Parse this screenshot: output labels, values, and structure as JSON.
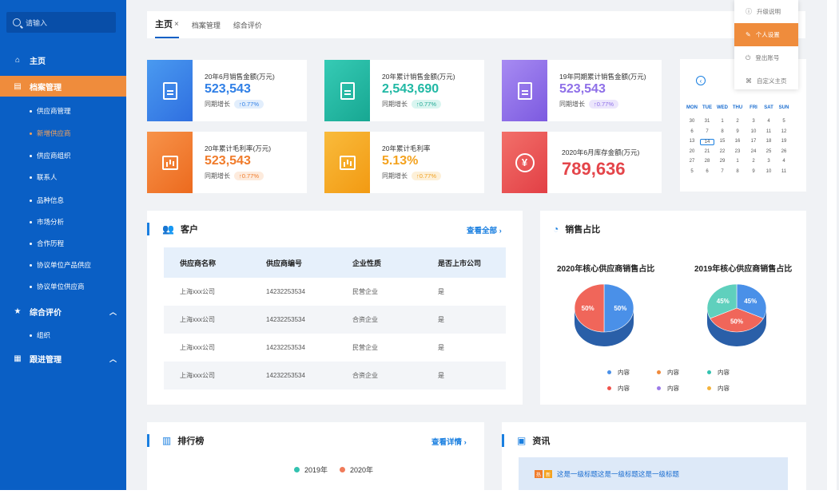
{
  "search": {
    "placeholder": "请输入"
  },
  "sidebar": {
    "top": [
      {
        "label": "主页",
        "icon": "home-icon"
      },
      {
        "label": "档案管理",
        "icon": "archive-icon"
      },
      {
        "label": "综合评价",
        "icon": "star-icon"
      },
      {
        "label": "跟进管理",
        "icon": "follow-icon"
      }
    ],
    "archive_sub": [
      "供应商管理",
      "新增供应商",
      "供应商组织",
      "联系人",
      "品种信息",
      "市场分析",
      "合作历程",
      "协议单位产品供应",
      "协议单位供应商"
    ],
    "eval_sub": [
      "组织"
    ]
  },
  "tabs": {
    "home": "主页",
    "close": "×",
    "archive": "档案管理",
    "eval": "综合评价"
  },
  "dropdown": [
    "升级说明",
    "个人设置",
    "登出账号",
    "自定义主页"
  ],
  "cards": [
    {
      "title": "20年6月销售金额(万元)",
      "value": "523,543",
      "cmp_label": "同期增长",
      "cmp": "↑0.77%",
      "color": "#2f7fe6"
    },
    {
      "title": "20年累计销售金额(万元)",
      "value": "2,543,690",
      "cmp_label": "同期增长",
      "cmp": "↑0.77%",
      "color": "#20b8a4"
    },
    {
      "title": "19年同期累计销售金额(万元)",
      "value": "523,543",
      "cmp_label": "同期增长",
      "cmp": "↑0.77%",
      "color": "#8e6fe8"
    },
    {
      "title": "20年累计毛利率(万元)",
      "value": "523,543",
      "cmp_label": "同期增长",
      "cmp": "↑0.77%",
      "color": "#f07b2a"
    },
    {
      "title": "20年累计毛利率",
      "value": "5.13%",
      "cmp_label": "同期增长",
      "cmp": "↑0.77%",
      "color": "#f4a21e"
    },
    {
      "title": "2020年6月库存金额(万元)",
      "value": "789,636",
      "color": "#e4454a"
    }
  ],
  "calendar": {
    "dow": [
      "MON",
      "TUE",
      "WED",
      "THU",
      "FRI",
      "SAT",
      "SUN"
    ],
    "weeks": [
      [
        "30",
        "31",
        "1",
        "2",
        "3",
        "4",
        "5"
      ],
      [
        "6",
        "7",
        "8",
        "9",
        "10",
        "11",
        "12"
      ],
      [
        "13",
        "14",
        "15",
        "16",
        "17",
        "18",
        "19"
      ],
      [
        "20",
        "21",
        "22",
        "23",
        "24",
        "25",
        "26"
      ],
      [
        "27",
        "28",
        "29",
        "1",
        "2",
        "3",
        "4"
      ],
      [
        "5",
        "6",
        "7",
        "8",
        "9",
        "10",
        "11"
      ]
    ],
    "today": "14"
  },
  "customers": {
    "title": "客户",
    "more": "查看全部 ›",
    "columns": [
      "供应商名称",
      "供应商编号",
      "企业性质",
      "是否上市公司"
    ],
    "rows": [
      [
        "上海xxx公司",
        "14232253534",
        "民营企业",
        "是"
      ],
      [
        "上海xxx公司",
        "14232253534",
        "合资企业",
        "是"
      ],
      [
        "上海xxx公司",
        "14232253534",
        "民营企业",
        "是"
      ],
      [
        "上海xxx公司",
        "14232253534",
        "合资企业",
        "是"
      ]
    ]
  },
  "sales_share": {
    "title": "销售占比",
    "legend": [
      {
        "label": "内容",
        "color": "#4a90e8"
      },
      {
        "label": "内容",
        "color": "#f08a3c"
      },
      {
        "label": "内容",
        "color": "#33c2b0"
      },
      {
        "label": "内容",
        "color": "#f0524b"
      },
      {
        "label": "内容",
        "color": "#9b7ae8"
      },
      {
        "label": "内容",
        "color": "#f4b33c"
      }
    ]
  },
  "ranking": {
    "title": "排行榜",
    "more": "查看详情 ›",
    "legend": [
      {
        "label": "2019年",
        "color": "#33c2b0"
      },
      {
        "label": "2020年",
        "color": "#f07b5a"
      }
    ]
  },
  "news": {
    "title": "资讯",
    "item": "这是一级标题这是一级标题这是一级标题",
    "tag1": "热",
    "tag2": "新"
  },
  "chart_data": [
    {
      "type": "pie",
      "title": "2020年核心供应商销售占比",
      "labels": [
        "",
        ""
      ],
      "values": [
        50,
        50
      ],
      "colors": [
        "#4a90e8",
        "#f0665a"
      ]
    },
    {
      "type": "pie",
      "title": "2019年核心供应商销售占比",
      "labels": [
        "",
        "",
        ""
      ],
      "values": [
        45,
        50,
        45
      ],
      "colors": [
        "#4a90e8",
        "#f0665a",
        "#5fd0bd"
      ]
    }
  ]
}
